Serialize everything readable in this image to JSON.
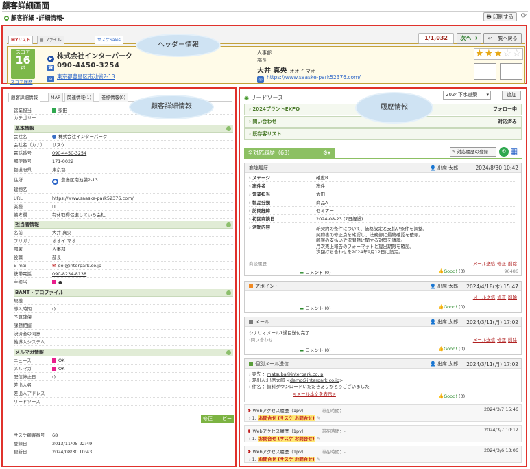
{
  "page": {
    "title": "顧客詳細画面",
    "subtitle": "顧客詳細 -詳細情報-",
    "print": "印刷する"
  },
  "header": {
    "tabs": [
      "MYリスト",
      "ファイル\nストレージ",
      "サスケSales"
    ],
    "pager": "1/1,032",
    "next": "次へ",
    "back": "一覧へ戻る",
    "score": {
      "label": "スコア",
      "value": "16",
      "unit": "pt",
      "link": "スコア履歴"
    },
    "company": "株式会社インターパーク",
    "phone": "090-4450-3254",
    "address": "東京都豊島区南池袋2-13",
    "dept": "人事部",
    "position": "部長",
    "person": "大井 真央",
    "person_kana": "オオイ マオ",
    "url": "https://www.saaske-park52376.com/",
    "rating": 3,
    "rating_max": 5,
    "stars_filled": "★★★",
    "stars_empty": "☆☆"
  },
  "annotations": {
    "header": "ヘッダー情報",
    "detail": "顧客詳細情報",
    "history": "履歴情報"
  },
  "left": {
    "tabs": [
      "顧客詳細情報",
      "MAP",
      "関連情報(1)",
      "巻標情報(0)"
    ],
    "top": [
      {
        "label": "営業担当",
        "value": "柴田"
      },
      {
        "label": "カテゴリー",
        "value": ""
      }
    ],
    "basic_title": "基本情報",
    "basic": [
      {
        "label": "会社名",
        "value": "株式会社インターパーク"
      },
      {
        "label": "会社名（カナ）",
        "value": "サスケ"
      },
      {
        "label": "電話番号",
        "value": "090-4450-3254"
      },
      {
        "label": "郵便番号",
        "value": "171-0022"
      },
      {
        "label": "都道府県",
        "value": "東京都"
      },
      {
        "label": "住所",
        "value": "豊島区南池袋2-13"
      },
      {
        "label": "建物名",
        "value": ""
      },
      {
        "label": "URL",
        "value": "https://www.saaske-park52376.com/"
      },
      {
        "label": "業種",
        "value": "IT"
      },
      {
        "label": "備考欄",
        "value": "有休取得促進している会社"
      }
    ],
    "contact_title": "担当者情報",
    "contact": [
      {
        "label": "名前",
        "value": "大井 真央"
      },
      {
        "label": "フリガナ",
        "value": "オオイ マオ"
      },
      {
        "label": "部署",
        "value": "人事部"
      },
      {
        "label": "役職",
        "value": "部長"
      },
      {
        "label": "E-mail",
        "value": "goi@interpark.co.jp"
      },
      {
        "label": "携帯電話",
        "value": "090-8234-8138"
      },
      {
        "label": "主担当",
        "value": "●"
      }
    ],
    "bant_title": "BANT・プロファイル",
    "bant": [
      {
        "label": "規模",
        "value": ""
      },
      {
        "label": "導入時期",
        "value": "()"
      },
      {
        "label": "予算確保",
        "value": ""
      },
      {
        "label": "課題把握",
        "value": ""
      },
      {
        "label": "決済者の同意",
        "value": ""
      },
      {
        "label": "他導入システム",
        "value": ""
      }
    ],
    "mail_title": "メルマガ情報",
    "mail": [
      {
        "label": "ニュース",
        "value": "OK"
      },
      {
        "label": "メルマガ",
        "value": "OK"
      },
      {
        "label": "配信停止日",
        "value": "()"
      },
      {
        "label": "差出人名",
        "value": ""
      },
      {
        "label": "差出人アドレス",
        "value": ""
      },
      {
        "label": "リードソース",
        "value": ""
      }
    ],
    "btn_edit": "修正",
    "btn_copy": "コピー",
    "footer": [
      {
        "label": "サスケ顧客番号",
        "value": "68"
      },
      {
        "label": "登録日",
        "value": "2013/11/05 22:49"
      },
      {
        "label": "更新日",
        "value": "2024/08/30 10:43"
      }
    ]
  },
  "right": {
    "lead_source": "リードソース",
    "period": "2024下水道築",
    "add": "追加",
    "leads": [
      {
        "name": "2024プラントEXPO",
        "status": "フォロー中"
      },
      {
        "name": "問い合わせ",
        "status": "対応済み"
      },
      {
        "name": "既存客リスト",
        "status": ""
      }
    ],
    "history_tab": "全対応履歴（63）",
    "register": "対応履歴の登録",
    "e1": {
      "type": "商談履歴",
      "user": "出席 太郎",
      "date": "2024/8/30 10:42",
      "fields": [
        {
          "k": "ステージ",
          "v": "確度B"
        },
        {
          "k": "案件名",
          "v": "案件"
        },
        {
          "k": "営業担当",
          "v": "太田"
        },
        {
          "k": "製品分類",
          "v": "商品A"
        },
        {
          "k": "訪問経緯",
          "v": "セミナー"
        },
        {
          "k": "初回商談日",
          "v": "2024-08-23 (7日経過)"
        },
        {
          "k": "活動内容",
          "v": ""
        }
      ],
      "memo": [
        "新契約の条件について、価格設定と支払い条件を調整。",
        "契約書の修正点を確認し、法務部に最終確認を依頼。",
        "顧客の支払い近況問題に関する対策を議論。",
        "月次売上報告のフォーマットと提出期限を確認。",
        "次回打ち合わせを2024年9月12日に設定。"
      ],
      "source": "商談履歴",
      "id": "96486"
    },
    "e2": {
      "type": "アポイント",
      "user": "出席 太郎",
      "date": "2024/4/18(木) 15:47"
    },
    "e3": {
      "type": "メール",
      "user": "出席 太郎",
      "date": "2024/3/11(月) 17:02",
      "body": "シナリオメール1通目送付完了",
      "sub": "問い合わせ"
    },
    "e4": {
      "type": "個別メール送信",
      "user": "出席 太郎",
      "date": "2024/3/11(月) 17:02",
      "to": "matsuba@interpark.co.jp",
      "from_name": "出席太郎",
      "from": "demo@interpark.co.jp",
      "subject": "資料ダウンロードいただきありがとうございました",
      "show": "<メール本文を表示>"
    },
    "web": [
      {
        "title": "Webアクセス履歴（1pv）",
        "stay": "滞在時間：-",
        "date": "2024/3/7 15:46",
        "page": "お問合せ (サスケ  お問合せ)"
      },
      {
        "title": "Webアクセス履歴（1pv）",
        "stay": "滞在時間：-",
        "date": "2024/3/7 10:12",
        "page": "お問合せ (サスケ  お問合せ)"
      },
      {
        "title": "Webアクセス履歴（1pv）",
        "stay": "滞在時間：-",
        "date": "2024/3/6 13:06",
        "page": "お問合せ (サスケ  お問合せ)"
      }
    ],
    "act_mail": "メール送信",
    "act_edit": "修正",
    "act_del": "削除",
    "comment": "コメント",
    "comment_count": "(0)",
    "good": "Good!",
    "good_count": "(0)"
  }
}
